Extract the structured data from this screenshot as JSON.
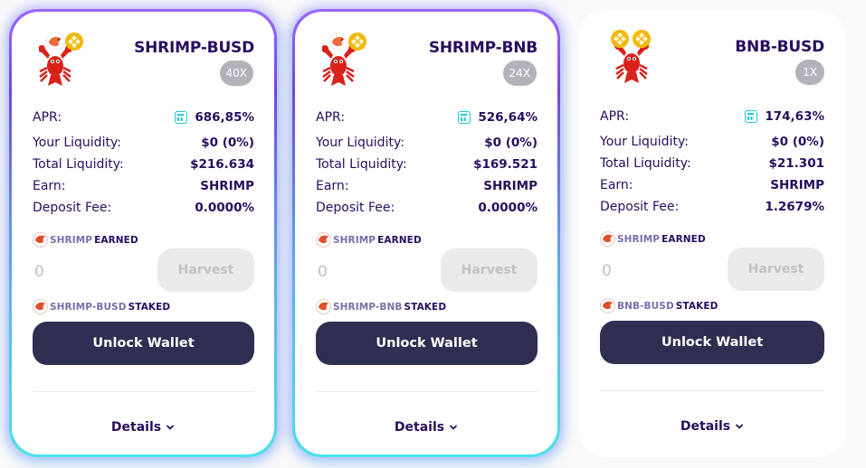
{
  "cards": [
    {
      "title": "SHRIMP-BUSD",
      "multiplier": "40X",
      "tokens": [
        "shrimp",
        "busd"
      ],
      "apr_label": "APR:",
      "apr": "686,85%",
      "rows": [
        {
          "label": "Your Liquidity:",
          "value": "$0 (0%)"
        },
        {
          "label": "Total Liquidity:",
          "value": "$216.634"
        },
        {
          "label": "Earn:",
          "value": "SHRIMP"
        },
        {
          "label": "Deposit Fee:",
          "value": "0.0000%"
        }
      ],
      "earned_token": "SHRIMP",
      "earned_word": "EARNED",
      "earned_value": "0",
      "harvest_label": "Harvest",
      "staked_token": "SHRIMP-BUSD",
      "staked_word": "STAKED",
      "unlock_label": "Unlock Wallet",
      "details_label": "Details"
    },
    {
      "title": "SHRIMP-BNB",
      "multiplier": "24X",
      "tokens": [
        "shrimp",
        "bnb"
      ],
      "apr_label": "APR:",
      "apr": "526,64%",
      "rows": [
        {
          "label": "Your Liquidity:",
          "value": "$0 (0%)"
        },
        {
          "label": "Total Liquidity:",
          "value": "$169.521"
        },
        {
          "label": "Earn:",
          "value": "SHRIMP"
        },
        {
          "label": "Deposit Fee:",
          "value": "0.0000%"
        }
      ],
      "earned_token": "SHRIMP",
      "earned_word": "EARNED",
      "earned_value": "0",
      "harvest_label": "Harvest",
      "staked_token": "SHRIMP-BNB",
      "staked_word": "STAKED",
      "unlock_label": "Unlock Wallet",
      "details_label": "Details"
    },
    {
      "title": "BNB-BUSD",
      "multiplier": "1X",
      "tokens": [
        "bnb",
        "busd"
      ],
      "apr_label": "APR:",
      "apr": "174,63%",
      "rows": [
        {
          "label": "Your Liquidity:",
          "value": "$0 (0%)"
        },
        {
          "label": "Total Liquidity:",
          "value": "$21.301"
        },
        {
          "label": "Earn:",
          "value": "SHRIMP"
        },
        {
          "label": "Deposit Fee:",
          "value": "1.2679%"
        }
      ],
      "earned_token": "SHRIMP",
      "earned_word": "EARNED",
      "earned_value": "0",
      "harvest_label": "Harvest",
      "staked_token": "BNB-BUSD",
      "staked_word": "STAKED",
      "unlock_label": "Unlock Wallet",
      "details_label": "Details"
    }
  ],
  "colors": {
    "primary_text": "#280d5f",
    "button_dark": "#2f2f52",
    "accent_teal": "#1fc7d4",
    "lobster_red": "#d8221b",
    "coin_gold": "#f0b90b",
    "disabled_text": "#bdc2c4"
  },
  "icons": [
    "lobster-logo-icon",
    "shrimp-token-icon",
    "busd-token-icon",
    "bnb-token-icon",
    "calculator-icon",
    "chevron-down-icon"
  ]
}
